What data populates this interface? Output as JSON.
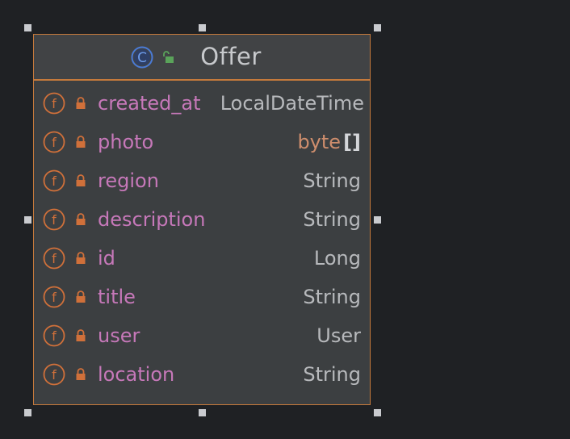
{
  "diagram": {
    "class_name": "Offer",
    "class_kind_icon": "class-icon",
    "visibility_icon": "unlock-icon",
    "fields": [
      {
        "icon": "field-icon",
        "access_icon": "lock-icon",
        "name": "created_at",
        "type": "LocalDateTime"
      },
      {
        "icon": "field-icon",
        "access_icon": "lock-icon",
        "name": "photo",
        "type_keyword": "byte",
        "type_suffix": "[]"
      },
      {
        "icon": "field-icon",
        "access_icon": "lock-icon",
        "name": "region",
        "type": "String"
      },
      {
        "icon": "field-icon",
        "access_icon": "lock-icon",
        "name": "description",
        "type": "String"
      },
      {
        "icon": "field-icon",
        "access_icon": "lock-icon",
        "name": "id",
        "type": "Long"
      },
      {
        "icon": "field-icon",
        "access_icon": "lock-icon",
        "name": "title",
        "type": "String"
      },
      {
        "icon": "field-icon",
        "access_icon": "lock-icon",
        "name": "user",
        "type": "User"
      },
      {
        "icon": "field-icon",
        "access_icon": "lock-icon",
        "name": "location",
        "type": "String"
      }
    ]
  },
  "colors": {
    "background": "#1f2124",
    "box_fill": "#3c3f41",
    "box_border": "#c57a3c",
    "field_name": "#c678b9",
    "type_text": "#b7b9bc",
    "keyword": "#cf8e6d",
    "class_icon": "#4a7bd6",
    "unlock_icon": "#5aa35a",
    "lock_icon": "#d0703a"
  }
}
